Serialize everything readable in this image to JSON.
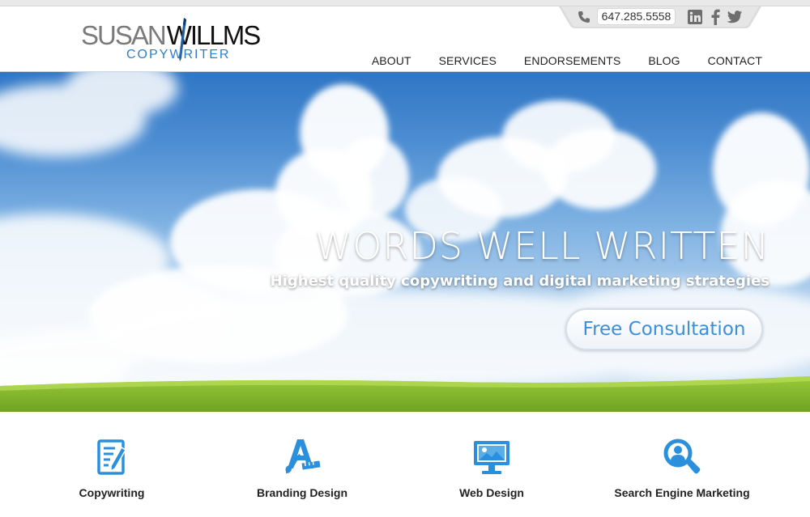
{
  "brand": {
    "first": "SUSAN",
    "last": "WILLMS",
    "tagline": "COPYWRITER",
    "colors": {
      "gray": "#7b7b7b",
      "dark": "#111111",
      "blue": "#2a7fcf"
    }
  },
  "contact": {
    "phone": "647.285.5558",
    "phone_icon": "phone-icon",
    "social": [
      {
        "name": "linkedin-icon",
        "glyph": "in"
      },
      {
        "name": "facebook-icon",
        "glyph": "f"
      },
      {
        "name": "twitter-icon",
        "glyph": "twitter"
      }
    ]
  },
  "nav": {
    "items": [
      "ABOUT",
      "SERVICES",
      "ENDORSEMENTS",
      "BLOG",
      "CONTACT"
    ]
  },
  "hero": {
    "title": "WORDS WELL WRITTEN",
    "subtitle": "Highest quality copywriting and digital marketing strategies",
    "cta": "Free Consultation",
    "accent": "#3b8fdc"
  },
  "services": {
    "accent": "#2a8fdc",
    "items": [
      {
        "label": "Copywriting",
        "icon": "document-pen-icon"
      },
      {
        "label": "Branding Design",
        "icon": "design-tools-icon"
      },
      {
        "label": "Web Design",
        "icon": "monitor-image-icon"
      },
      {
        "label": "Search Engine Marketing",
        "icon": "magnifier-user-icon"
      }
    ]
  }
}
